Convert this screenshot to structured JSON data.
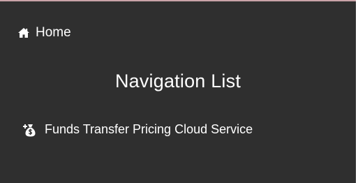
{
  "nav": {
    "home_label": "Home",
    "home_icon": "home-icon",
    "heading": "Navigation List",
    "items": [
      {
        "label": "Funds Transfer Pricing Cloud Service",
        "icon": "money-bag-icon"
      }
    ]
  },
  "colors": {
    "panel_background": "#2f2f2f",
    "text": "#ffffff",
    "top_border": "#c9a3a8"
  }
}
